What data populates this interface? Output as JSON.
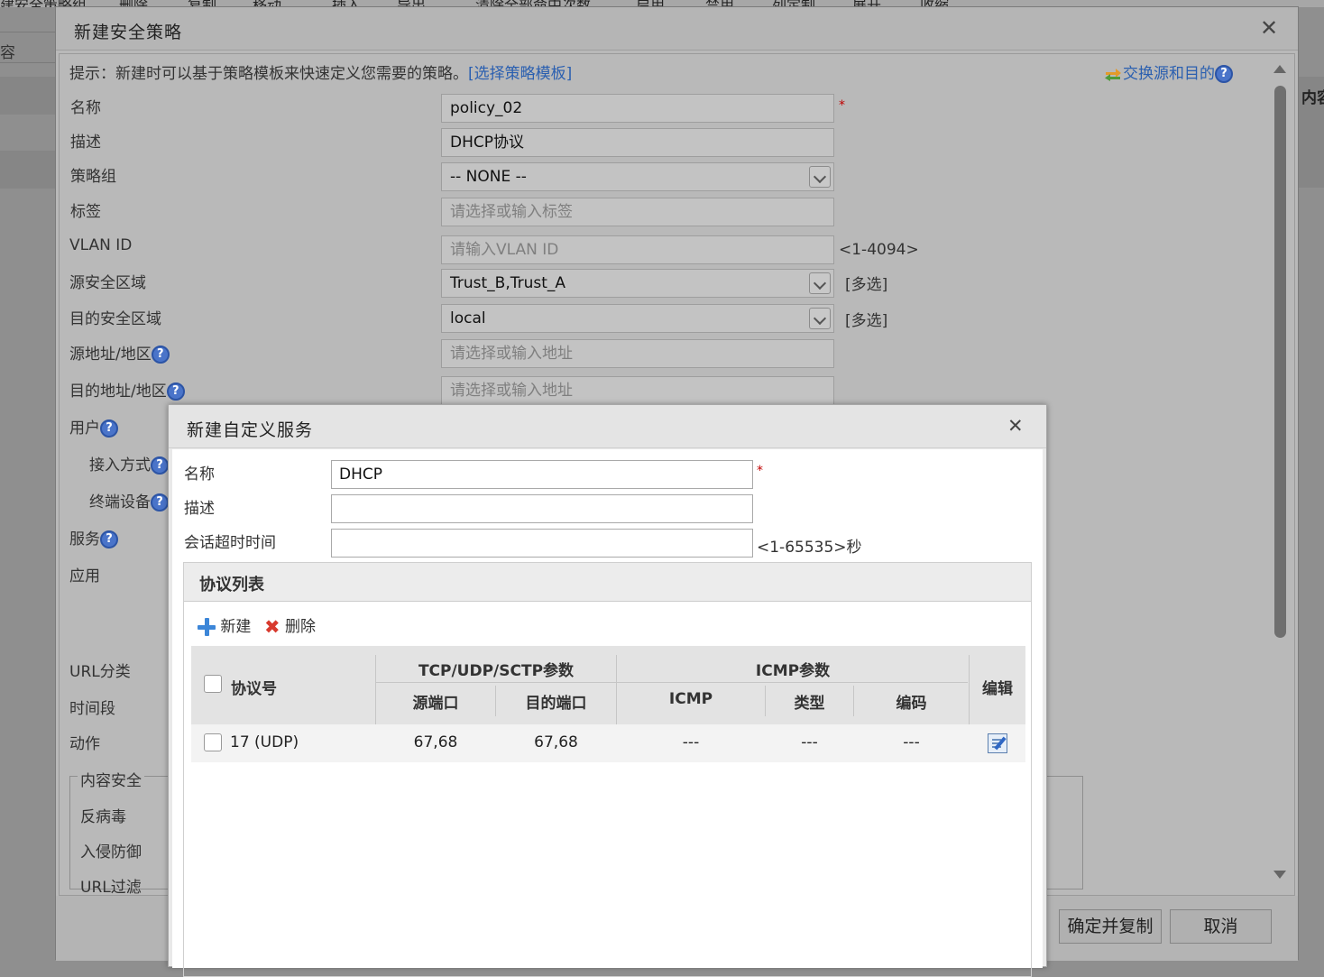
{
  "background": {
    "left_title": "建安全策略组",
    "toolbar": [
      "删除",
      "复制",
      "移动",
      "插入",
      "导出",
      "清除全部命中次数",
      "启用",
      "禁用",
      "列定制",
      "展开",
      "收缩"
    ],
    "left_label": "容",
    "right_label": "内容"
  },
  "policy_dialog": {
    "title": "新建安全策略",
    "hint_text": "提示：新建时可以基于策略模板来快速定义您需要的策略。",
    "hint_link": "[选择策略模板]",
    "swap_link": "交换源和目的",
    "help_glyph": "?",
    "fields": {
      "name": {
        "label": "名称",
        "value": "policy_02",
        "required": "*"
      },
      "description": {
        "label": "描述",
        "value": "DHCP协议"
      },
      "policy_group": {
        "label": "策略组",
        "value": "-- NONE --"
      },
      "tag": {
        "label": "标签",
        "placeholder": "请选择或输入标签"
      },
      "vlan_id": {
        "label": "VLAN ID",
        "placeholder": "请输入VLAN ID",
        "hint": "<1-4094>"
      },
      "src_zone": {
        "label": "源安全区域",
        "value": "Trust_B,Trust_A",
        "link": "[多选]"
      },
      "dst_zone": {
        "label": "目的安全区域",
        "value": "local",
        "link": "[多选]"
      },
      "src_addr": {
        "label": "源地址/地区",
        "placeholder": "请选择或输入地址"
      },
      "dst_addr": {
        "label": "目的地址/地区",
        "placeholder": "请选择或输入地址"
      },
      "user": {
        "label": "用户"
      },
      "access_mode": {
        "label": "接入方式"
      },
      "terminal": {
        "label": "终端设备"
      },
      "service": {
        "label": "服务"
      },
      "application": {
        "label": "应用"
      },
      "url_category": {
        "label": "URL分类"
      },
      "time_range": {
        "label": "时间段"
      },
      "action": {
        "label": "动作"
      }
    },
    "content_security": {
      "legend": "内容安全",
      "antivirus": "反病毒",
      "ips": "入侵防御",
      "url_filter": "URL过滤"
    },
    "buttons": {
      "confirm_copy": "确定并复制",
      "cancel": "取消"
    }
  },
  "service_dialog": {
    "title": "新建自定义服务",
    "name": {
      "label": "名称",
      "value": "DHCP",
      "required": "*"
    },
    "description": {
      "label": "描述",
      "value": ""
    },
    "timeout": {
      "label": "会话超时时间",
      "value": "",
      "hint": "<1-65535>秒"
    },
    "protocol_list": {
      "title": "协议列表",
      "toolbar": {
        "new": "新建",
        "delete": "删除"
      },
      "headers": {
        "protocol": "协议号",
        "tcp_group": "TCP/UDP/SCTP参数",
        "src_port": "源端口",
        "dst_port": "目的端口",
        "icmp_group": "ICMP参数",
        "icmp": "ICMP",
        "type": "类型",
        "code": "编码",
        "edit": "编辑"
      },
      "rows": [
        {
          "protocol": "17 (UDP)",
          "src_port": "67,68",
          "dst_port": "67,68",
          "icmp": "---",
          "type": "---",
          "code": "---"
        }
      ]
    }
  }
}
